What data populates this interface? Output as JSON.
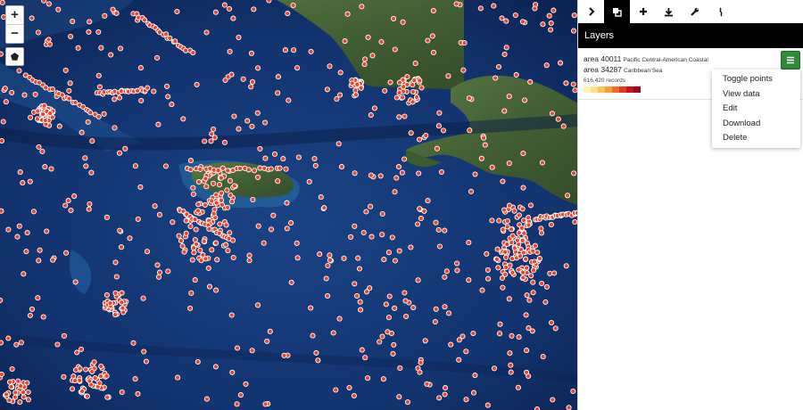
{
  "map": {
    "zoom_in_label": "+",
    "zoom_out_label": "−",
    "draw_icon": "pentagon-icon",
    "ocean_color": "#153a73",
    "land_color": "#4a6b3a",
    "point_color": "#e8452c"
  },
  "tabs": [
    {
      "icon": "chevron-right-icon",
      "active": false
    },
    {
      "icon": "layers-icon",
      "active": true
    },
    {
      "icon": "plus-icon",
      "active": false
    },
    {
      "icon": "download-icon",
      "active": false
    },
    {
      "icon": "wrench-icon",
      "active": false
    },
    {
      "icon": "bookmark-icon",
      "active": false
    }
  ],
  "panel": {
    "title": "Layers"
  },
  "layer": {
    "area1_code": "area 40011",
    "area1_desc": "Pacific Central-American Coastal",
    "area2_code": "area 34287",
    "area2_desc": "Caribbean Sea",
    "records": "616,420 records",
    "legend_colors": [
      "#fff5b4",
      "#fee08a",
      "#fdc25a",
      "#fc9a3c",
      "#f56b2b",
      "#e23a1f",
      "#c5141c",
      "#a50021"
    ],
    "menu_button_color": "#2f8a3a"
  },
  "menu": {
    "items": [
      "Toggle points",
      "View data",
      "Edit",
      "Download",
      "Delete"
    ]
  }
}
